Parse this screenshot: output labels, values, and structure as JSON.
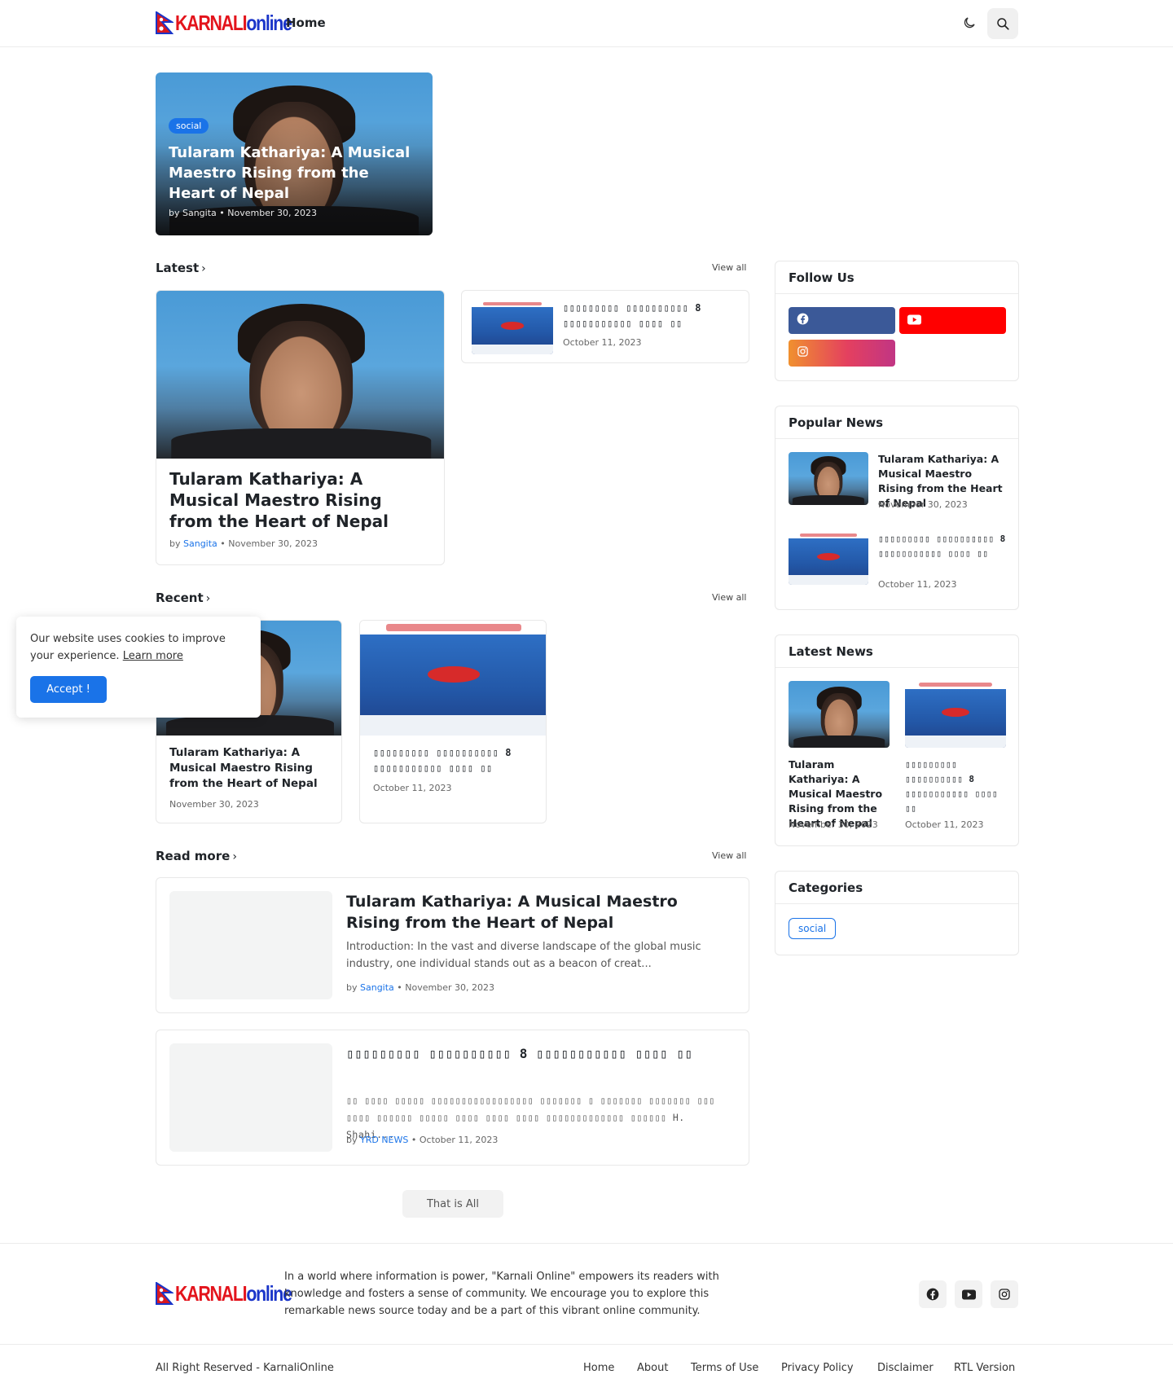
{
  "brand": {
    "name_part1": "KARNALI",
    "name_part2": "online",
    "red": "#e3141c",
    "blue": "#1a35c9"
  },
  "nav": {
    "home": "Home",
    "theme_icon": "moon-icon",
    "search_icon": "search-icon"
  },
  "hero": {
    "tag": "social",
    "title": "Tularam Kathariya: A Musical Maestro Rising from the Heart of Nepal",
    "meta": "by Sangita • November 30, 2023"
  },
  "latest": {
    "title": "Latest",
    "view_all": "View all",
    "main": {
      "title": "Tularam Kathariya: A Musical Maestro Rising from the Heart of Nepal",
      "by": "by",
      "author": "Sangita",
      "date": "• November 30, 2023"
    },
    "side": {
      "title": "▯▯▯▯▯▯▯▯▯ ▯▯▯▯▯▯▯▯▯▯ 8 ▯▯▯▯▯▯▯▯▯▯▯ ▯▯▯▯ ▯▯",
      "date": "October 11, 2023"
    }
  },
  "recent": {
    "title": "Recent",
    "view_all": "View all",
    "items": [
      {
        "title": "Tularam Kathariya: A Musical Maestro Rising from the Heart of Nepal",
        "date": "November 30, 2023"
      },
      {
        "title": "▯▯▯▯▯▯▯▯▯ ▯▯▯▯▯▯▯▯▯▯ 8 ▯▯▯▯▯▯▯▯▯▯▯ ▯▯▯▯ ▯▯",
        "date": "October 11, 2023"
      }
    ]
  },
  "read_more": {
    "title": "Read more",
    "view_all": "View all",
    "items": [
      {
        "title": "Tularam Kathariya: A Musical Maestro Rising from the Heart of Nepal",
        "excerpt": "Introduction: In the vast and diverse landscape of the global music industry, one individual stands out as a beacon of creat...",
        "by": "by",
        "author": "Sangita",
        "date": "• November 30, 2023"
      },
      {
        "title": "▯▯▯▯▯▯▯▯▯ ▯▯▯▯▯▯▯▯▯▯ 8 ▯▯▯▯▯▯▯▯▯▯▯ ▯▯▯▯ ▯▯",
        "excerpt": "▯▯ ▯▯▯▯ ▯▯▯▯▯ ▯▯▯▯▯▯▯▯▯▯▯▯▯▯▯▯▯ ▯▯▯▯▯▯▯ ▯ ▯▯▯▯▯▯▯ ▯▯▯▯▯▯▯ ▯▯▯ ▯▯▯▯ ▯▯▯▯▯▯ ▯▯▯▯▯ ▯▯▯▯ ▯▯▯▯ ▯▯▯▯ ▯▯▯▯▯▯▯▯▯▯▯▯▯ ▯▯▯▯▯▯ H. Shahi...",
        "by": "by",
        "author": "YRD NEWS",
        "date": "• October 11, 2023"
      }
    ],
    "end_label": "That is All"
  },
  "sidebar": {
    "follow": {
      "title": "Follow Us",
      "facebook": "#3b5998",
      "youtube": "#ff0000"
    },
    "popular": {
      "title": "Popular News",
      "items": [
        {
          "title": "Tularam Kathariya: A Musical Maestro Rising from the Heart of Nepal",
          "date": "November 30, 2023"
        },
        {
          "title": "▯▯▯▯▯▯▯▯▯ ▯▯▯▯▯▯▯▯▯▯ 8 ▯▯▯▯▯▯▯▯▯▯▯ ▯▯▯▯ ▯▯",
          "date": "October 11, 2023"
        }
      ]
    },
    "latest_news": {
      "title": "Latest News",
      "items": [
        {
          "title": "Tularam Kathariya: A Musical Maestro Rising from the Heart of Nepal",
          "date": "November 30, 2023"
        },
        {
          "title": "▯▯▯▯▯▯▯▯▯ ▯▯▯▯▯▯▯▯▯▯ 8 ▯▯▯▯▯▯▯▯▯▯▯ ▯▯▯▯ ▯▯",
          "date": "October 11, 2023"
        }
      ]
    },
    "categories": {
      "title": "Categories",
      "items": [
        "social"
      ]
    }
  },
  "cookie": {
    "text": "Our website uses cookies to improve your experience.",
    "learn_more": "Learn more",
    "accept": "Accept !"
  },
  "footer": {
    "about": "In a world where information is power, \"Karnali Online\" empowers its readers with knowledge and fosters a sense of community. We encourage you to explore this remarkable news source today and be a part of this vibrant online community.",
    "copyright": "All Right Reserved - KarnaliOnline",
    "links": [
      "Home",
      "About",
      "Terms of Use",
      "Privacy Policy",
      "Disclaimer",
      "RTL Version"
    ]
  }
}
